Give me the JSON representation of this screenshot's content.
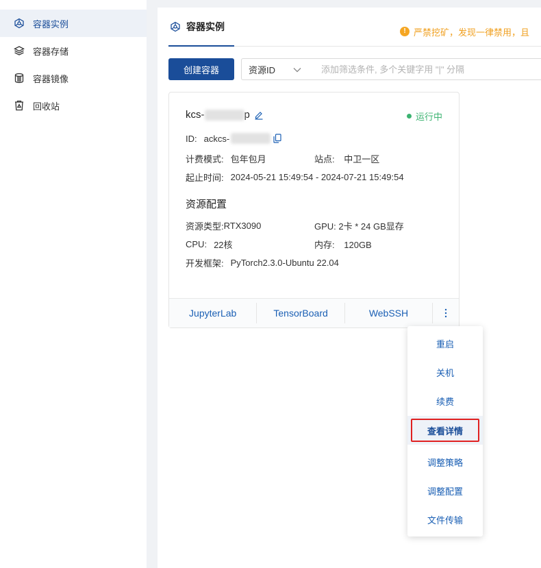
{
  "sidebar": {
    "items": [
      {
        "label": "容器实例",
        "icon": "container-instance-icon",
        "active": true
      },
      {
        "label": "容器存储",
        "icon": "storage-stack-icon",
        "active": false
      },
      {
        "label": "容器镜像",
        "icon": "image-cylinder-icon",
        "active": false
      },
      {
        "label": "回收站",
        "icon": "recycle-bin-icon",
        "active": false
      }
    ]
  },
  "main": {
    "tab_label": "容器实例",
    "notice": "严禁挖矿，发现一律禁用，且",
    "create_button": "创建容器",
    "filter": {
      "select_value": "资源ID",
      "placeholder": "添加筛选条件, 多个关键字用 \"|\" 分隔"
    }
  },
  "card": {
    "name_prefix": "kcs-",
    "name_suffix": "p",
    "status": "运行中",
    "id_label": "ID:",
    "id_value": "ackcs-",
    "billing_label": "计费模式:",
    "billing_value": "包年包月",
    "site_label": "站点:",
    "site_value": "中卫一区",
    "time_label": "起止时间:",
    "time_value": "2024-05-21 15:49:54 - 2024-07-21 15:49:54",
    "section_title": "资源配置",
    "resource_type_label": "资源类型:",
    "resource_type_value": "RTX3090",
    "gpu_label": "GPU:",
    "gpu_value": "2卡 * 24 GB显存",
    "cpu_label": "CPU:",
    "cpu_value": "22核",
    "memory_label": "内存:",
    "memory_value": "120GB",
    "framework_label": "开发框架:",
    "framework_value": "PyTorch2.3.0-Ubuntu 22.04",
    "footer_links": [
      "JupyterLab",
      "TensorBoard",
      "WebSSH"
    ],
    "more_icon": "more-vertical-icon"
  },
  "dropdown": {
    "items": [
      "重启",
      "关机",
      "续费",
      "查看详情",
      "调整策略",
      "调整配置",
      "文件传输"
    ],
    "highlighted": "查看详情"
  },
  "colors": {
    "primary": "#1a4d99",
    "link": "#1a5fb4",
    "running": "#3cb371",
    "warning": "#f0a020",
    "highlight_border": "#e02020"
  }
}
